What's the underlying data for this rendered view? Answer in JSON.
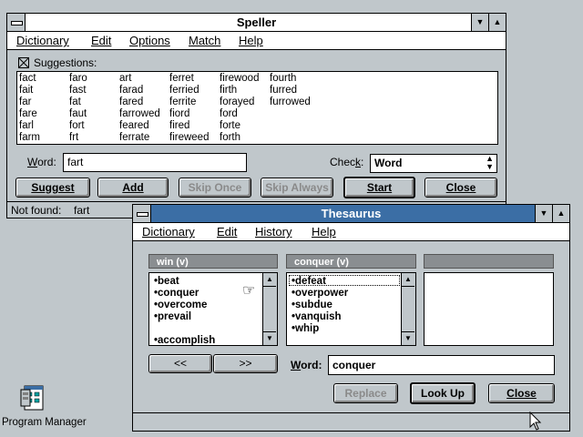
{
  "speller": {
    "title": "Speller",
    "menu": [
      "Dictionary",
      "Edit",
      "Options",
      "Match",
      "Help"
    ],
    "suggestions_label": "Suggestions:",
    "suggestions_columns": [
      [
        "fact",
        "fait",
        "far",
        "fare",
        "farl",
        "farm"
      ],
      [
        "faro",
        "fast",
        "fat",
        "faut",
        "fort",
        "frt"
      ],
      [
        "art",
        "farad",
        "fared",
        "farrowed",
        "feared",
        "ferrate"
      ],
      [
        "ferret",
        "ferried",
        "ferrite",
        "fiord",
        "fired",
        "fireweed"
      ],
      [
        "firewood",
        "firth",
        "forayed",
        "ford",
        "forte",
        "forth"
      ],
      [
        "fourth",
        "furred",
        "furrowed"
      ]
    ],
    "word_label": "Word:",
    "word_value": "fart",
    "check_label": "Check:",
    "check_value": "Word",
    "buttons": {
      "suggest": "Suggest",
      "add": "Add",
      "skip_once": "Skip Once",
      "skip_always": "Skip Always",
      "start": "Start",
      "close": "Close"
    },
    "status_label": "Not found:",
    "status_value": "fart"
  },
  "thesaurus": {
    "title": "Thesaurus",
    "menu": [
      "Dictionary",
      "Edit",
      "History",
      "Help"
    ],
    "panel1_header": "win (v)",
    "panel1_items": [
      "beat",
      "conquer",
      "overcome",
      "prevail",
      "",
      "accomplish"
    ],
    "panel2_header": "conquer (v)",
    "panel2_items": [
      "defeat",
      "overpower",
      "subdue",
      "vanquish",
      "whip"
    ],
    "panel3_header": "",
    "back_button": "<<",
    "forward_button": ">>",
    "word_label": "Word:",
    "word_value": "conquer",
    "buttons": {
      "replace": "Replace",
      "lookup": "Look Up",
      "close": "Close"
    }
  },
  "desktop": {
    "program_manager_label": "Program Manager"
  },
  "colors": {
    "desktop": "#c0c7cb",
    "active_title": "#3b6ea5"
  }
}
